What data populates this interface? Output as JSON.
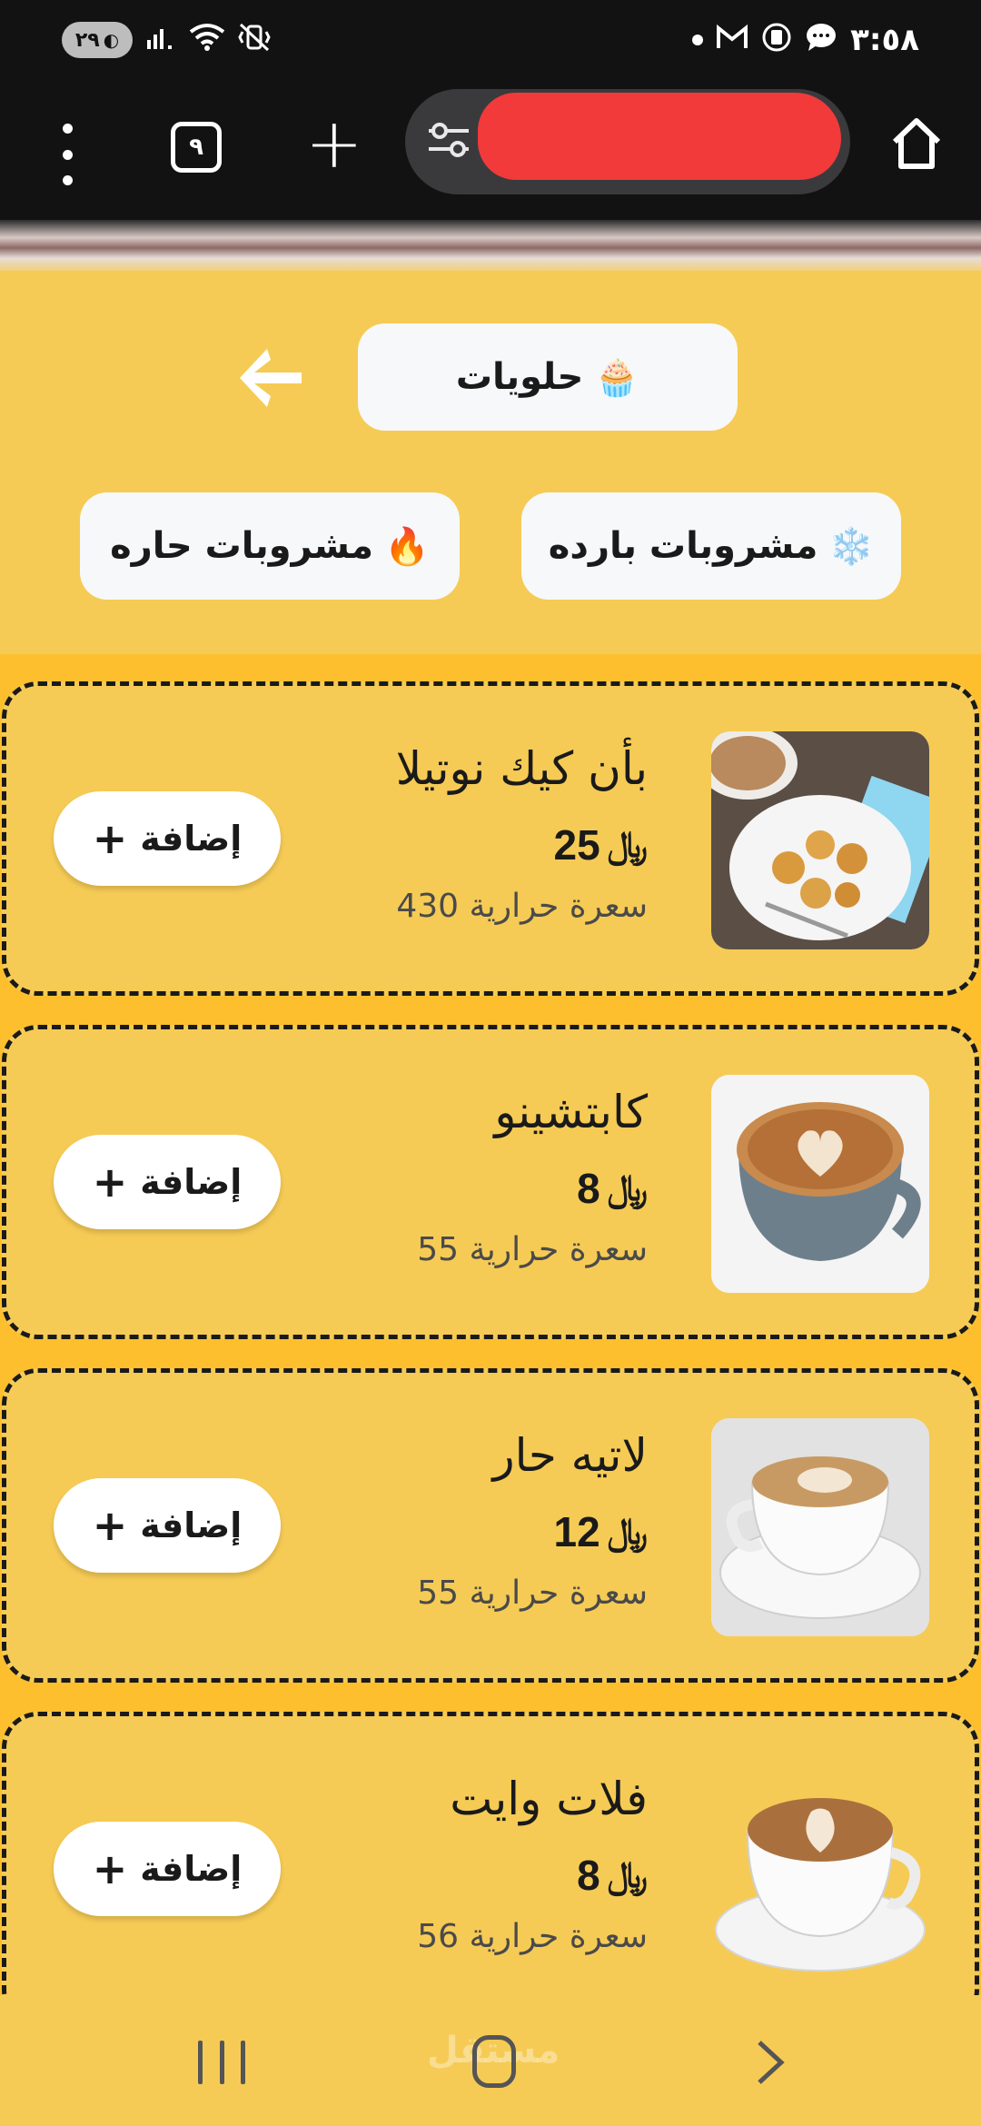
{
  "status_bar": {
    "time": "٣:٥٨",
    "battery_level": "٢٩",
    "icons_left": [
      "battery-icon",
      "signal-icon",
      "wifi-icon",
      "vibrate-icon"
    ],
    "icons_right": [
      "notification-dot-icon",
      "gmail-icon",
      "sim-icon",
      "message-icon"
    ]
  },
  "browser": {
    "tab_count": "٩",
    "url": ""
  },
  "categories": {
    "sweets": {
      "label": "حلويات",
      "emoji": "🧁"
    },
    "cold_drinks": {
      "label": "مشروبات بارده",
      "emoji": "❄️"
    },
    "hot_drinks": {
      "label": "مشروبات حاره",
      "emoji": "🔥"
    }
  },
  "products": [
    {
      "name": "بأن كيك نوتيلا",
      "price": "25",
      "currency": "﷼",
      "calories": "سعرة حرارية 430",
      "add_label": "إضافة",
      "image": "pancake-image"
    },
    {
      "name": "كابتشينو",
      "price": "8",
      "currency": "﷼",
      "calories": "سعرة حرارية 55",
      "add_label": "إضافة",
      "image": "cappuccino-image"
    },
    {
      "name": "لاتيه حار",
      "price": "12",
      "currency": "﷼",
      "calories": "سعرة حرارية 55",
      "add_label": "إضافة",
      "image": "latte-image"
    },
    {
      "name": "فلات وايت",
      "price": "8",
      "currency": "﷼",
      "calories": "سعرة حرارية 56",
      "add_label": "إضافة",
      "image": "flat-white-image"
    }
  ],
  "watermark": "مستقل",
  "colors": {
    "background": "#f6cb55",
    "list_background": "#fdbf2d",
    "card_border": "#1a1a1a",
    "button_bg": "#ffffff",
    "status_bar": "#121212",
    "redaction": "#f23a3a"
  }
}
